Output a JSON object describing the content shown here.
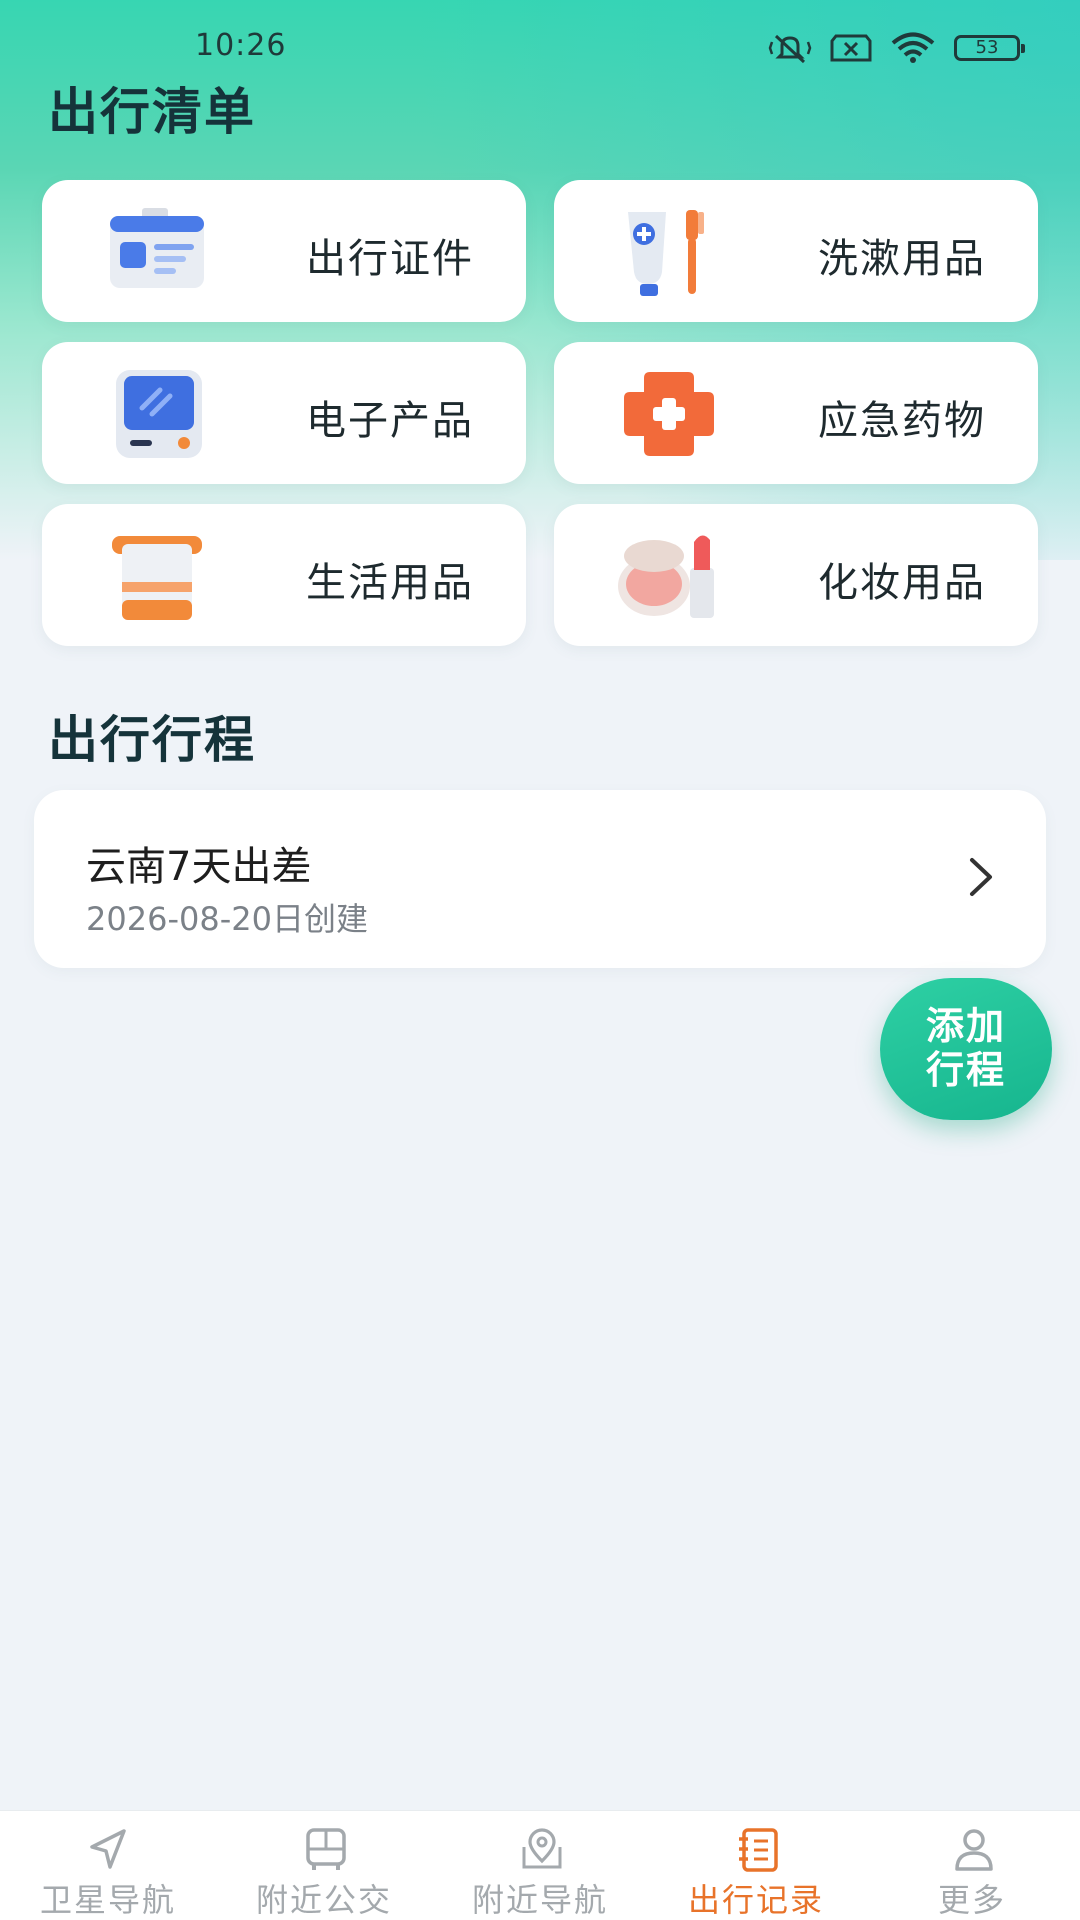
{
  "status_bar": {
    "time": "10:26",
    "battery": "53"
  },
  "checklist": {
    "title": "出行清单",
    "items": [
      {
        "label": "出行证件",
        "icon": "id-card-icon"
      },
      {
        "label": "洗漱用品",
        "icon": "toiletries-icon"
      },
      {
        "label": "电子产品",
        "icon": "tablet-icon"
      },
      {
        "label": "应急药物",
        "icon": "medical-cross-icon"
      },
      {
        "label": "生活用品",
        "icon": "towel-icon"
      },
      {
        "label": "化妆用品",
        "icon": "cosmetics-icon"
      }
    ]
  },
  "itinerary": {
    "title": "出行行程",
    "trips": [
      {
        "name": "云南7天出差",
        "created": "2026-08-20日创建"
      }
    ],
    "add_button": {
      "line1": "添加",
      "line2": "行程"
    }
  },
  "tabbar": {
    "tabs": [
      {
        "label": "卫星导航",
        "icon": "navigation-arrow-icon",
        "active": false
      },
      {
        "label": "附近公交",
        "icon": "bus-icon",
        "active": false
      },
      {
        "label": "附近导航",
        "icon": "map-pin-icon",
        "active": false
      },
      {
        "label": "出行记录",
        "icon": "notebook-icon",
        "active": true
      },
      {
        "label": "更多",
        "icon": "person-icon",
        "active": false
      }
    ]
  },
  "colors": {
    "accent": "#e8732a",
    "brand": "#2ed0a4",
    "title": "#15333a"
  }
}
